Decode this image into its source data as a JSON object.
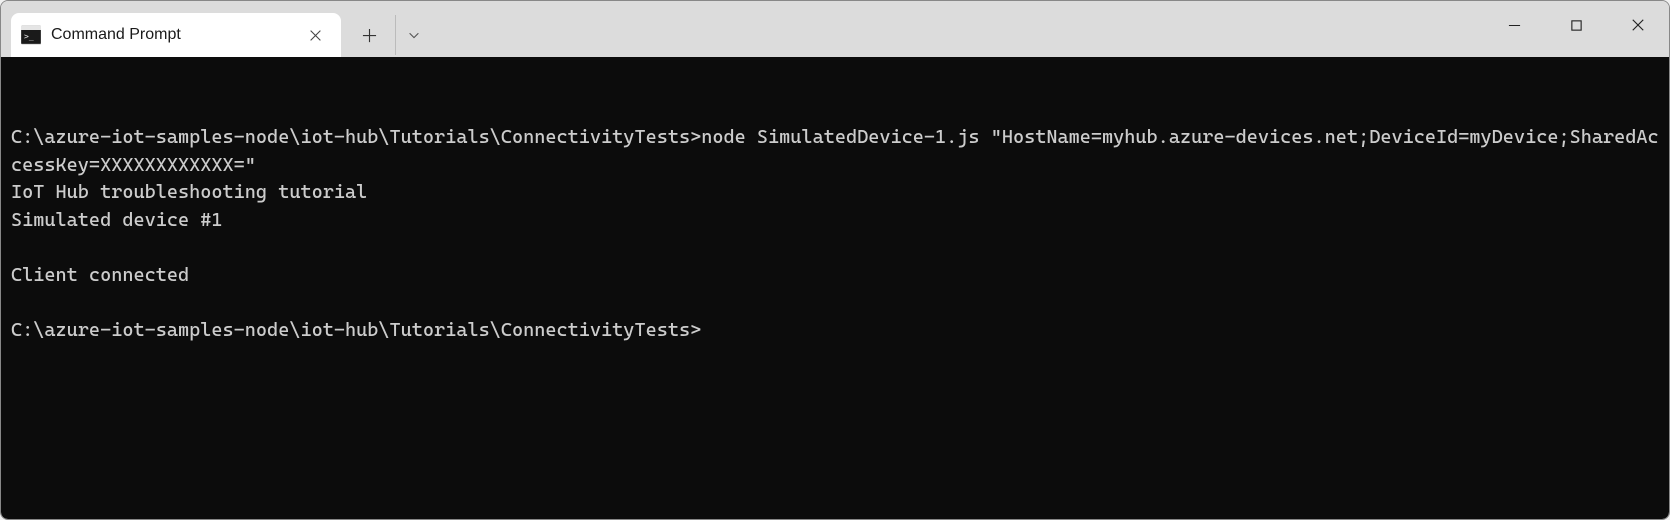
{
  "tab": {
    "title": "Command Prompt"
  },
  "terminal": {
    "lines": [
      "C:\\azure-iot-samples-node\\iot-hub\\Tutorials\\ConnectivityTests>node SimulatedDevice-1.js \"HostName=myhub.azure-devices.net;DeviceId=myDevice;SharedAccessKey=XXXXXXXXXXXX=\"",
      "IoT Hub troubleshooting tutorial",
      "Simulated device #1",
      "",
      "Client connected",
      "",
      "C:\\azure-iot-samples-node\\iot-hub\\Tutorials\\ConnectivityTests>"
    ]
  }
}
